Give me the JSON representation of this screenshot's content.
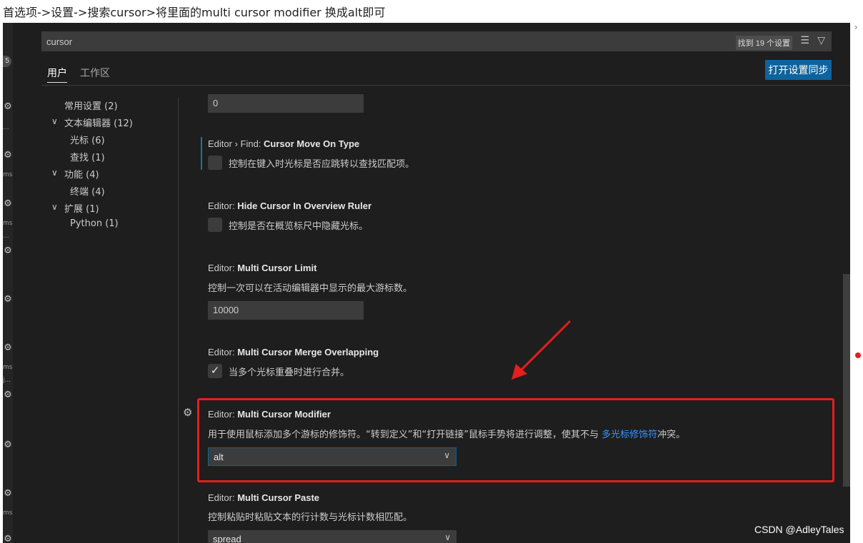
{
  "caption": "首选项->设置->搜索cursor>将里面的multi cursor modifier 换成alt即可",
  "activity_bar": {
    "badge": "5",
    "labels": [
      "...",
      "ms",
      "ms",
      "...",
      "ms",
      "j...",
      "ms"
    ]
  },
  "search": {
    "value": "cursor",
    "result_count": "找到 19 个设置"
  },
  "tabs": {
    "user": "用户",
    "workspace": "工作区"
  },
  "sync_button": "打开设置同步",
  "toc": {
    "items": [
      {
        "label": "常用设置 (2)"
      },
      {
        "label": "文本编辑器 (12)",
        "expanded": true
      },
      {
        "label": "光标 (6)"
      },
      {
        "label": "查找 (1)"
      },
      {
        "label": "功能 (4)",
        "expanded": true
      },
      {
        "label": "终端 (4)"
      },
      {
        "label": "扩展 (1)",
        "expanded": true
      },
      {
        "label": "Python (1)"
      }
    ]
  },
  "settings": {
    "top_value": "0",
    "find_cursor": {
      "prefix": "Editor › Find: ",
      "name": "Cursor Move On Type",
      "desc": "控制在键入时光标是否应跳转以查找匹配项。",
      "checked": false
    },
    "hide_cursor": {
      "prefix": "Editor: ",
      "name": "Hide Cursor In Overview Ruler",
      "desc": "控制是否在概览标尺中隐藏光标。",
      "checked": false
    },
    "cursor_limit": {
      "prefix": "Editor: ",
      "name": "Multi Cursor Limit",
      "desc": "控制一次可以在活动编辑器中显示的最大游标数。",
      "value": "10000"
    },
    "merge_overlapping": {
      "prefix": "Editor: ",
      "name": "Multi Cursor Merge Overlapping",
      "desc": "当多个光标重叠时进行合并。",
      "checked": true,
      "check_mark": "✓"
    },
    "modifier": {
      "prefix": "Editor: ",
      "name": "Multi Cursor Modifier",
      "desc_before": "用于使用鼠标添加多个游标的修饰符。“转到定义”和“打开链接”鼠标手势将进行调整，使其不与 ",
      "link": "多光标修饰符",
      "desc_after": "冲突。",
      "value": "alt"
    },
    "paste": {
      "prefix": "Editor: ",
      "name": "Multi Cursor Paste",
      "desc": "控制粘贴时粘贴文本的行计数与光标计数相匹配。",
      "value": "spread"
    }
  },
  "watermark": "CSDN @AdleyTales",
  "colors": {
    "highlight": "#e61e1e",
    "accent": "#0e639c",
    "link": "#3794ff"
  }
}
